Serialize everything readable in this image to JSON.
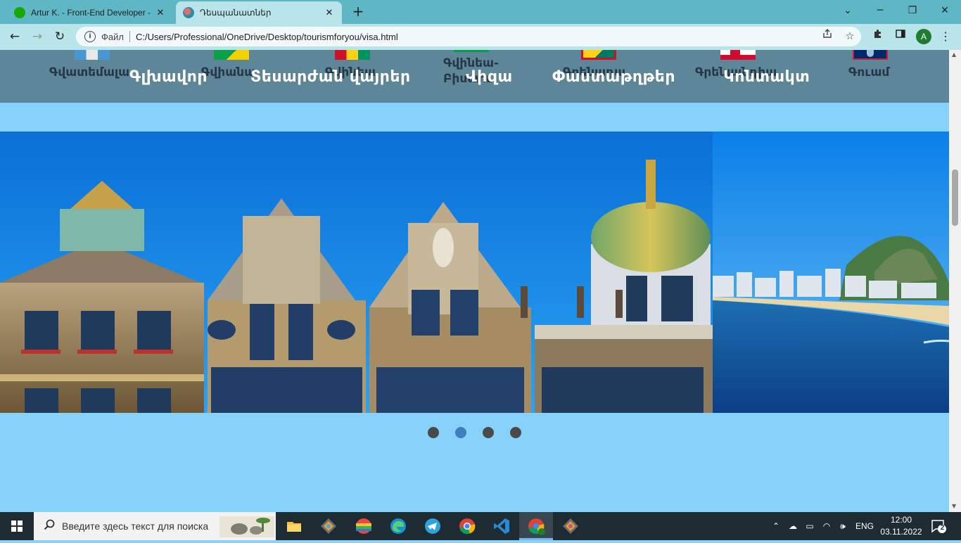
{
  "browser": {
    "tabs": [
      {
        "title": "Artur K. - Front-End Developer -",
        "active": false,
        "favicon_color": "#14a800"
      },
      {
        "title": "Դեսպանատներ",
        "active": true,
        "favicon_color": "#2a8fa0"
      }
    ],
    "new_tab": "+",
    "window_controls": {
      "minimize": "─",
      "restore": "❐",
      "close": "✕",
      "tabs_dropdown": "⌄"
    },
    "nav": {
      "back": "←",
      "forward": "→",
      "reload": "↻"
    },
    "address": {
      "info": "i",
      "scheme_label": "Файл",
      "url": "C:/Users/Professional/OneDrive/Desktop/tourismforyou/visa.html"
    },
    "profile_initial": "A"
  },
  "page": {
    "countries": [
      {
        "name": "Գվատեմալա",
        "flag": [
          "#4997d0",
          "#ffffff",
          "#4997d0"
        ]
      },
      {
        "name": "Գվիանա",
        "flag": [
          "#f5d000",
          "#f5d000",
          "#f5d000"
        ]
      },
      {
        "name": "Գվինեա",
        "flag": [
          "#ce1126",
          "#fcd116",
          "#009460"
        ]
      },
      {
        "name": "Գվինեա-Բիսաու",
        "flag": [
          "#ce1126",
          "#fcd116",
          "#009e49"
        ]
      },
      {
        "name": "Գրենադա",
        "flag": [
          "#ce1126",
          "#007a5e",
          "#fcd116"
        ]
      },
      {
        "name": "Գրենլանդիա",
        "flag": [
          "#d00c33",
          "#ffffff",
          "#d00c33"
        ]
      },
      {
        "name": "Գուամ",
        "flag": [
          "#00296b",
          "#00296b",
          "#00296b"
        ]
      }
    ],
    "nav": [
      {
        "label": "Գլխավոր"
      },
      {
        "label": "Տեսարժան վայրեր"
      },
      {
        "label": "Վիզա"
      },
      {
        "label": "Փաստաթղթեր"
      },
      {
        "label": "Կոնտակտ"
      }
    ],
    "slider": {
      "slide_count": 4,
      "active_index": 1
    }
  },
  "taskbar": {
    "search_placeholder": "Введите здесь текст для поиска",
    "language": "ENG",
    "time": "12:00",
    "date": "03.11.2022",
    "notifications": "2"
  },
  "colors": {
    "page_bg": "#86d2fb",
    "header_bg": "#5d8799",
    "tab_strip": "#5fb6c4",
    "toolbar": "#b9e4ea"
  }
}
